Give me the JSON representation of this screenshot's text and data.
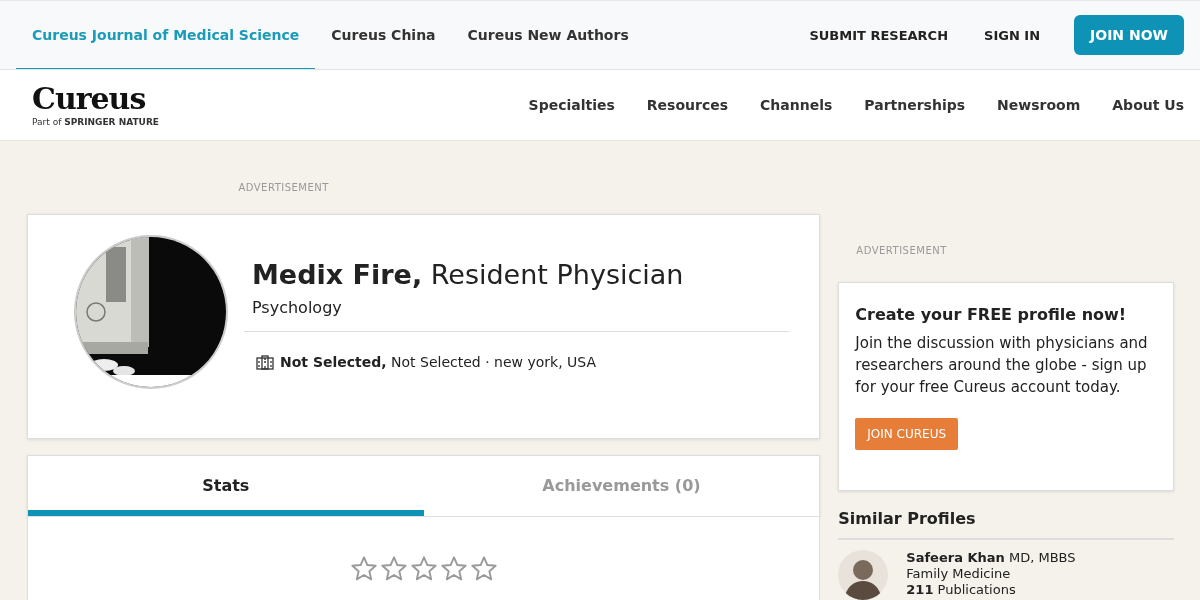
{
  "top_nav": {
    "sites": [
      {
        "label": "Cureus Journal of Medical Science",
        "selected": true
      },
      {
        "label": "Cureus China",
        "selected": false
      },
      {
        "label": "Cureus New Authors",
        "selected": false
      }
    ],
    "submit": "SUBMIT RESEARCH",
    "sign_in": "SIGN IN",
    "join": "JOIN NOW"
  },
  "header": {
    "logo": "Cureus",
    "logo_sub": "Part of **SPRINGER NATURE**",
    "menu": [
      "Specialties",
      "Resources",
      "Channels",
      "Partnerships",
      "Newsroom",
      "About Us"
    ]
  },
  "ad_label_left": "ADVERTISEMENT",
  "profile": {
    "name": "**Medix Fire,** Resident Physician",
    "specialty": "Psychology",
    "location": "**Not Selected,** Not Selected · new york, USA"
  },
  "tabs": [
    {
      "label": "Stats",
      "selected": true
    },
    {
      "label": "Achievements (0)",
      "selected": false
    }
  ],
  "rating": {
    "stars": 0
  },
  "sidebar": {
    "ad_label": "ADVERTISEMENT",
    "promo_title": "Create your FREE profile now!",
    "promo_text": "Join the discussion with physicians and researchers around the globe - sign up for your free Cureus account today.",
    "promo_button": "JOIN CUREUS",
    "similar_title": "Similar Profiles",
    "similar": [
      {
        "name": "Safeera Khan",
        "degree": "MD, MBBS",
        "specialty": "Family Medicine",
        "count": "211",
        "count_label": "Publications"
      }
    ]
  }
}
